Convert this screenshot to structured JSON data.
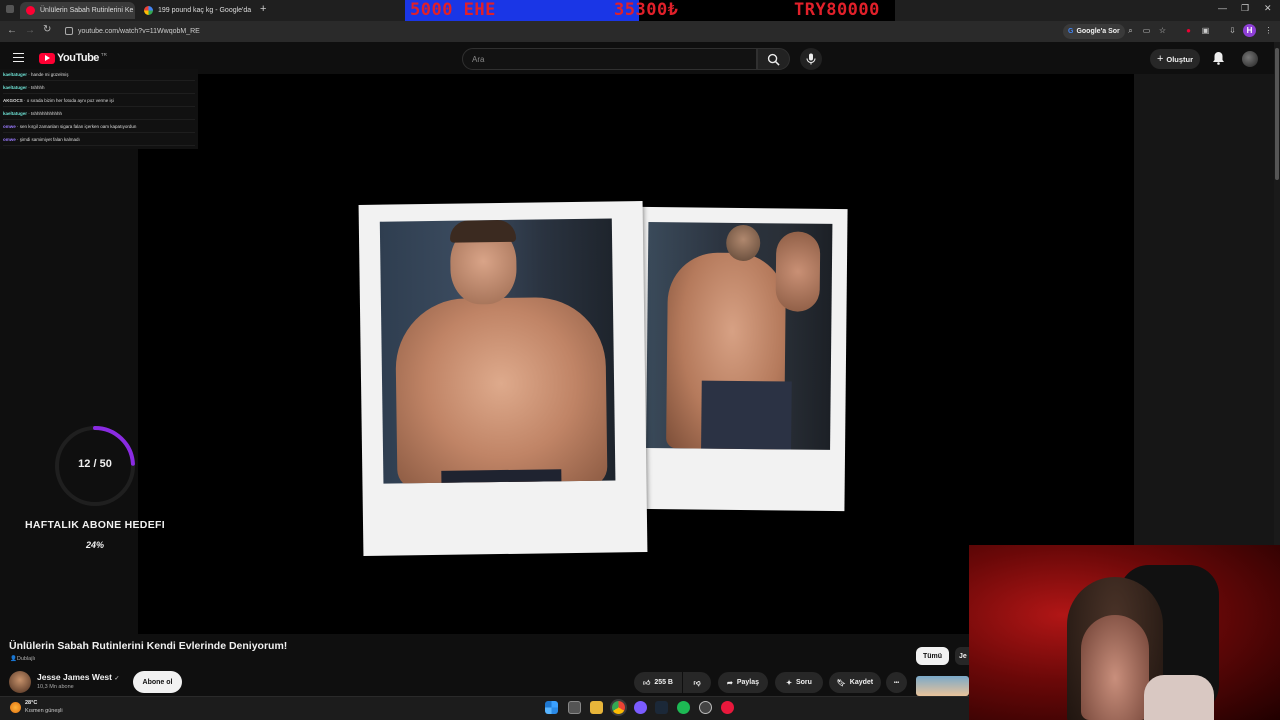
{
  "browser": {
    "tabs": [
      {
        "title": "Ünlülerin Sabah Rutinlerini Ke",
        "active": true
      },
      {
        "title": "199 pound kaç kg - Google'da",
        "active": false
      }
    ],
    "new_tab": "+",
    "url": "youtube.com/watch?v=11WwqobM_RE",
    "google_sor": "Google'a Sor",
    "profile_initial": "H"
  },
  "stream_overlay": {
    "left_text": "5000 EHE",
    "mid_text": "35300₺",
    "right_text": "TRY80000",
    "colors": {
      "blue": "#1a36e6",
      "red": "#e0202a"
    }
  },
  "youtube": {
    "logo_text": "YouTube",
    "logo_region": "TR",
    "search_placeholder": "Ara",
    "create_label": "Oluştur"
  },
  "chat": [
    {
      "user": "kaeltatuger",
      "msg": "hande mi güzelmiş",
      "color": "#6fe3d6"
    },
    {
      "user": "kaeltatuger",
      "msg": "tshhhh",
      "color": "#6fe3d6"
    },
    {
      "user": "AKGOCS",
      "msg": "o sırada bizim her fotoda aynı poz verme işi",
      "color": "#f1f1f1"
    },
    {
      "user": "kaeltatuger",
      "msg": "tshhhhhhhhhhh",
      "color": "#6fe3d6"
    },
    {
      "user": "omwe",
      "msg": "sen kırgil zamanları sigara falan içerken oam kapatıyordun",
      "color": "#9b7bff"
    },
    {
      "user": "omwe",
      "msg": "şimdi samimiyet falan kalmadı",
      "color": "#9b7bff"
    }
  ],
  "goal": {
    "count": "12 / 50",
    "title": "HAFTALIK ABONE HEDEFI",
    "percent_label": "24%",
    "progress": 0.24,
    "ring_color": "#8a2be2"
  },
  "video": {
    "title": "Ünlülerin Sabah Rutinlerini Kendi Evlerinde Deniyorum!",
    "dubbed": "Dublajlı",
    "channel": "Jesse James West",
    "verified": "✓",
    "subscribers": "10,3 Mn abone",
    "subscribe_label": "Abone ol",
    "likes": "255 B",
    "share": "Paylaş",
    "ask": "Soru",
    "save": "Kaydet",
    "more": "•••"
  },
  "recommendations": {
    "chip_all": "Tümü",
    "chip_next": "Je"
  },
  "taskbar": {
    "temperature": "28°C",
    "weather": "Kısmen güneşli"
  }
}
